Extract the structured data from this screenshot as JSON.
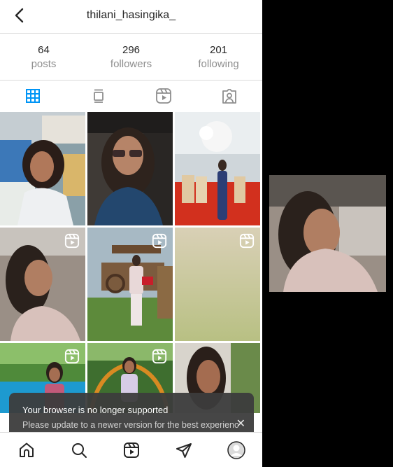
{
  "header": {
    "username": "thilani_hasingika_"
  },
  "stats": [
    {
      "value": "64",
      "label": "posts"
    },
    {
      "value": "296",
      "label": "followers"
    },
    {
      "value": "201",
      "label": "following"
    }
  ],
  "tabs": [
    {
      "icon": "grid-icon",
      "active": true
    },
    {
      "icon": "feed-icon",
      "active": false
    },
    {
      "icon": "reels-icon",
      "active": false
    },
    {
      "icon": "tagged-icon",
      "active": false
    }
  ],
  "colors": {
    "accent": "#0095f6",
    "text": "#262626",
    "muted": "#8e8e8e",
    "border": "#dbdbdb"
  },
  "toast": {
    "title": "Your browser is no longer supported",
    "message": "Please update to a newer version for the best experience.",
    "close_label": "✕"
  },
  "bottom_nav": [
    "home-icon",
    "search-icon",
    "reels-icon",
    "direct-icon",
    "profile-icon"
  ]
}
